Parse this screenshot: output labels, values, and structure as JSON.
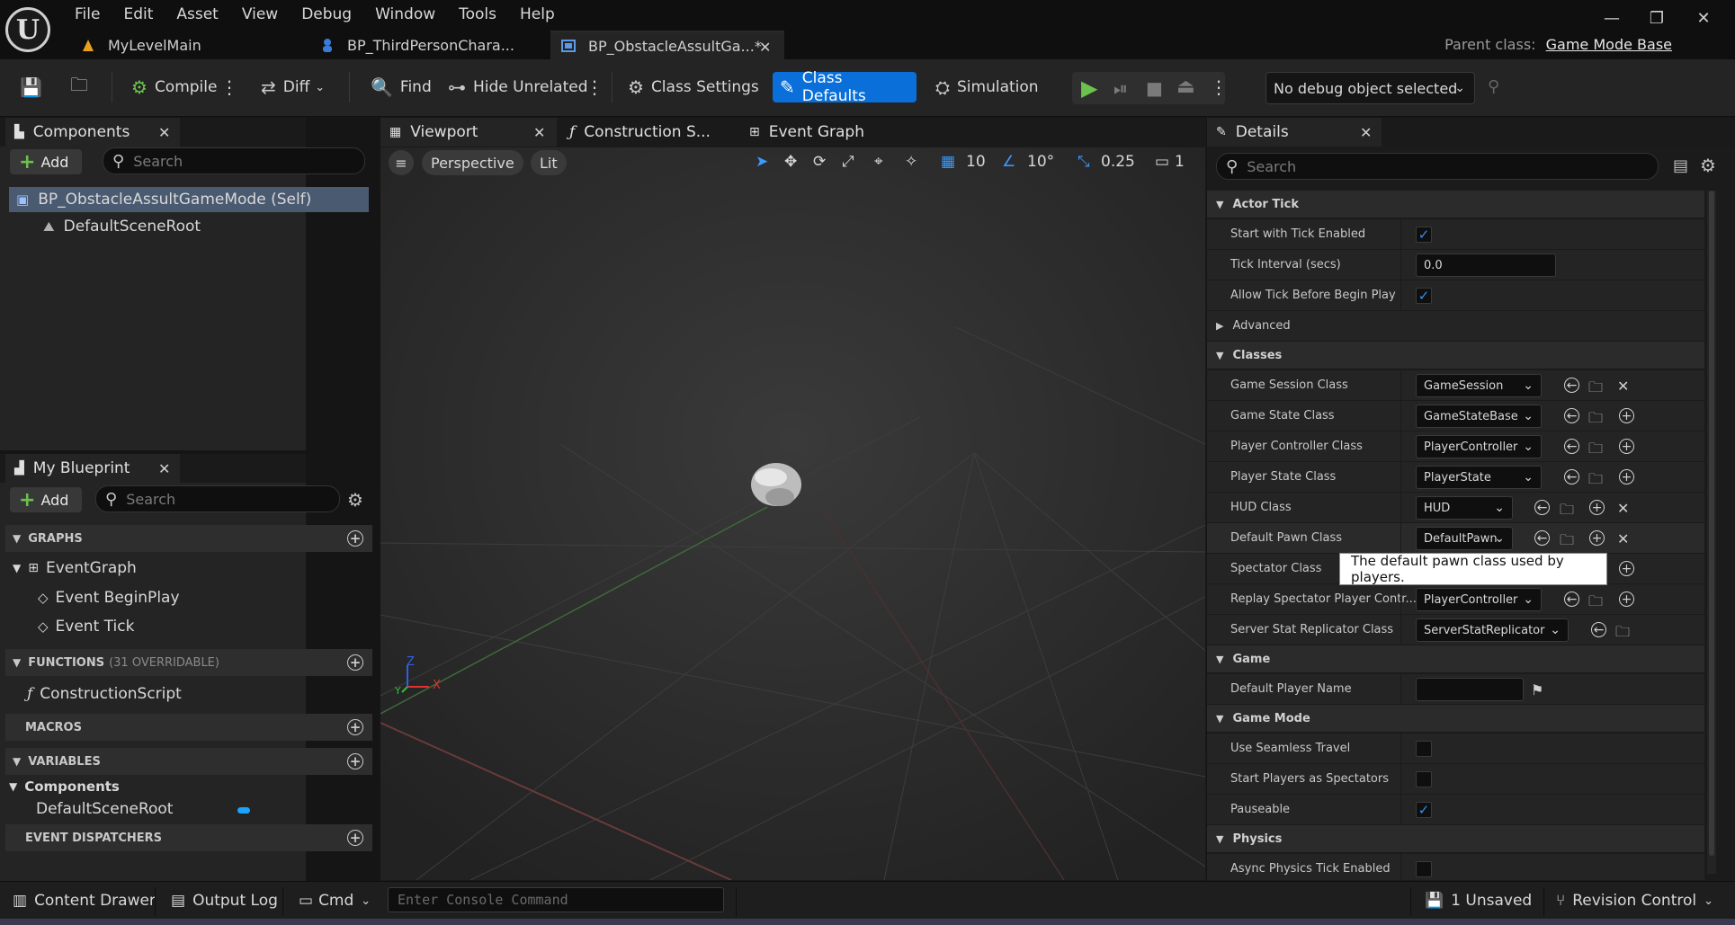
{
  "menu": [
    "File",
    "Edit",
    "Asset",
    "View",
    "Debug",
    "Window",
    "Tools",
    "Help"
  ],
  "window_controls": {
    "minimize": "—",
    "restore": "❐",
    "close": "✕"
  },
  "doc_tabs": [
    {
      "label": "MyLevelMain"
    },
    {
      "label": "BP_ThirdPersonChara..."
    },
    {
      "label": "BP_ObstacleAssultGa...*"
    }
  ],
  "parent_class": {
    "label": "Parent class:",
    "value": "Game Mode Base"
  },
  "toolbar": {
    "compile": "Compile",
    "diff": "Diff",
    "find": "Find",
    "hide_unrelated": "Hide Unrelated",
    "class_settings": "Class Settings",
    "class_defaults": "Class Defaults",
    "simulation": "Simulation",
    "debug_object": "No debug object selected"
  },
  "components": {
    "title": "Components",
    "add": "Add",
    "search_placeholder": "Search",
    "items": [
      "BP_ObstacleAssultGameMode (Self)",
      "DefaultSceneRoot"
    ]
  },
  "my_blueprint": {
    "title": "My Blueprint",
    "add": "Add",
    "search_placeholder": "Search",
    "graphs_header": "GRAPHS",
    "graph_name": "EventGraph",
    "events": [
      "Event BeginPlay",
      "Event Tick"
    ],
    "functions_header": "FUNCTIONS",
    "functions_overridable": "(31 OVERRIDABLE)",
    "function_items": [
      "ConstructionScript"
    ],
    "macros_header": "MACROS",
    "variables_header": "VARIABLES",
    "variables_category": "Components",
    "variable_items": [
      "DefaultSceneRoot"
    ],
    "dispatchers_header": "EVENT DISPATCHERS"
  },
  "viewport": {
    "tabs": [
      "Viewport",
      "Construction S...",
      "Event Graph"
    ],
    "perspective": "Perspective",
    "lit": "Lit",
    "grid_snap": "10",
    "rotation_snap": "10°",
    "scale_snap": "0.25",
    "camera_speed": "1",
    "axis_x": "X",
    "axis_z": "Z",
    "axis_y": "Y"
  },
  "details": {
    "title": "Details",
    "search_placeholder": "Search",
    "sections": {
      "actor_tick": "Actor Tick",
      "advanced": "Advanced",
      "classes": "Classes",
      "game": "Game",
      "game_mode": "Game Mode",
      "physics": "Physics"
    },
    "rows": {
      "start_tick": "Start with Tick Enabled",
      "tick_interval": "Tick Interval (secs)",
      "tick_interval_value": "0.0",
      "allow_tick": "Allow Tick Before Begin Play",
      "game_session": "Game Session Class",
      "game_session_value": "GameSession",
      "game_state": "Game State Class",
      "game_state_value": "GameStateBase",
      "player_controller": "Player Controller Class",
      "player_controller_value": "PlayerController",
      "player_state": "Player State Class",
      "player_state_value": "PlayerState",
      "hud": "HUD Class",
      "hud_value": "HUD",
      "default_pawn": "Default Pawn Class",
      "default_pawn_value": "DefaultPawn",
      "spectator": "Spectator Class",
      "replay_spectator": "Replay Spectator Player Contr...",
      "replay_spectator_value": "PlayerController",
      "server_stat": "Server Stat Replicator Class",
      "server_stat_value": "ServerStatReplicator",
      "default_player_name": "Default Player Name",
      "seamless_travel": "Use Seamless Travel",
      "start_spectators": "Start Players as Spectators",
      "pauseable": "Pauseable",
      "async_physics": "Async Physics Tick Enabled"
    },
    "tooltip": "The default pawn class used by players."
  },
  "statusbar": {
    "content_drawer": "Content Drawer",
    "output_log": "Output Log",
    "cmd": "Cmd",
    "console_placeholder": "Enter Console Command",
    "unsaved": "1 Unsaved",
    "revision_control": "Revision Control"
  },
  "colors": {
    "accent": "#0a6fd8",
    "play_green": "#6cc24a",
    "check_blue": "#2f8ff3"
  }
}
